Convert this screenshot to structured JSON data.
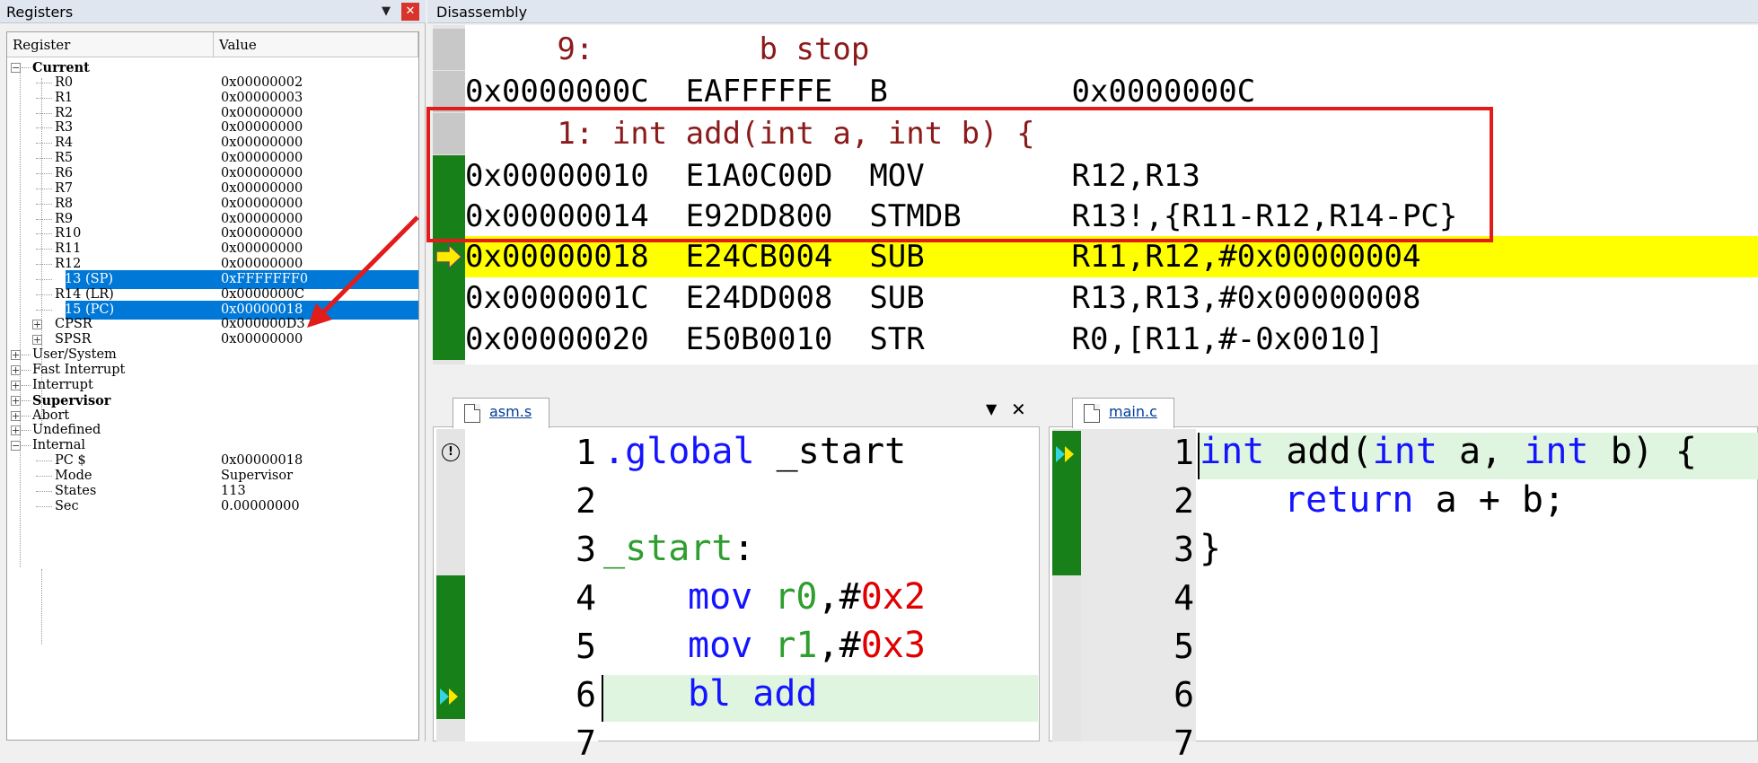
{
  "registers_panel": {
    "title": "Registers",
    "pin_icon": "pin-icon",
    "close_icon": "close-icon",
    "col_register": "Register",
    "col_value": "Value",
    "groups": {
      "current": "Current",
      "user_system": "User/System",
      "fast_interrupt": "Fast Interrupt",
      "interrupt": "Interrupt",
      "supervisor": "Supervisor",
      "abort": "Abort",
      "undefined": "Undefined",
      "internal": "Internal"
    },
    "current": [
      {
        "name": "R0",
        "value": "0x00000002"
      },
      {
        "name": "R1",
        "value": "0x00000003"
      },
      {
        "name": "R2",
        "value": "0x00000000"
      },
      {
        "name": "R3",
        "value": "0x00000000"
      },
      {
        "name": "R4",
        "value": "0x00000000"
      },
      {
        "name": "R5",
        "value": "0x00000000"
      },
      {
        "name": "R6",
        "value": "0x00000000"
      },
      {
        "name": "R7",
        "value": "0x00000000"
      },
      {
        "name": "R8",
        "value": "0x00000000"
      },
      {
        "name": "R9",
        "value": "0x00000000"
      },
      {
        "name": "R10",
        "value": "0x00000000"
      },
      {
        "name": "R11",
        "value": "0x00000000"
      },
      {
        "name": "R12",
        "value": "0x00000000"
      },
      {
        "name": "R13 (SP)",
        "value": "0xFFFFFFF0"
      },
      {
        "name": "R14 (LR)",
        "value": "0x0000000C"
      },
      {
        "name": "R15 (PC)",
        "value": "0x00000018"
      },
      {
        "name": "CPSR",
        "value": "0x000000D3"
      },
      {
        "name": "SPSR",
        "value": "0x00000000"
      }
    ],
    "internal": [
      {
        "name": "PC  $",
        "value": "0x00000018"
      },
      {
        "name": "Mode",
        "value": "Supervisor"
      },
      {
        "name": "States",
        "value": "113"
      },
      {
        "name": "Sec",
        "value": "0.00000000"
      }
    ]
  },
  "disassembly": {
    "title": "Disassembly",
    "lines": [
      {
        "kind": "src",
        "text": "     9:         b stop"
      },
      {
        "kind": "asm",
        "text": "0x0000000C  EAFFFFFE  B          0x0000000C"
      },
      {
        "kind": "src",
        "text": "     1: int add(int a, int b) {"
      },
      {
        "kind": "asm",
        "text": "0x00000010  E1A0C00D  MOV        R12,R13"
      },
      {
        "kind": "asm",
        "text": "0x00000014  E92DD800  STMDB      R13!,{R11-R12,R14-PC}"
      },
      {
        "kind": "asm",
        "text": "0x00000018  E24CB004  SUB        R11,R12,#0x00000004"
      },
      {
        "kind": "asm",
        "text": "0x0000001C  E24DD008  SUB        R13,R13,#0x00000008"
      },
      {
        "kind": "asm",
        "text": "0x00000020  E50B0010  STR        R0,[R11,#-0x0010]"
      }
    ]
  },
  "editor_asm": {
    "tab_label": "asm.s",
    "dropdown_icon": "chevron-down-icon",
    "close_icon": "close-icon",
    "line_numbers": [
      "1",
      "2",
      "3",
      "4",
      "5",
      "6",
      "7"
    ],
    "l1_kw": ".global",
    "l1_rest": " _start",
    "l3_label": "_start",
    "l3_colon": ":",
    "l4_kw": "mov",
    "l4_reg": "r0",
    "l4_comma": ",#",
    "l4_num": "0x2",
    "l5_kw": "mov",
    "l5_reg": "r1",
    "l5_comma": ",#",
    "l5_num": "0x3",
    "l6_kw": "bl",
    "l6_kw2": "add"
  },
  "editor_c": {
    "tab_label": "main.c",
    "line_numbers": [
      "1",
      "2",
      "3",
      "4",
      "5",
      "6",
      "7"
    ],
    "l1_kw1": "int",
    "l1_a": " add(",
    "l1_kw2": "int",
    "l1_b": " a, ",
    "l1_kw3": "int",
    "l1_c": " b) {",
    "l2_kw": "return",
    "l2_rest": " a + b;",
    "l3": "}"
  },
  "colors": {
    "selection": "#0078d7",
    "exec_highlight": "#ffff00",
    "annotation_red": "#e21b1b",
    "gutter_green": "#188018",
    "keyword_blue": "#1414ff",
    "register_green": "#2e9e2e",
    "number_red": "#e00000"
  }
}
